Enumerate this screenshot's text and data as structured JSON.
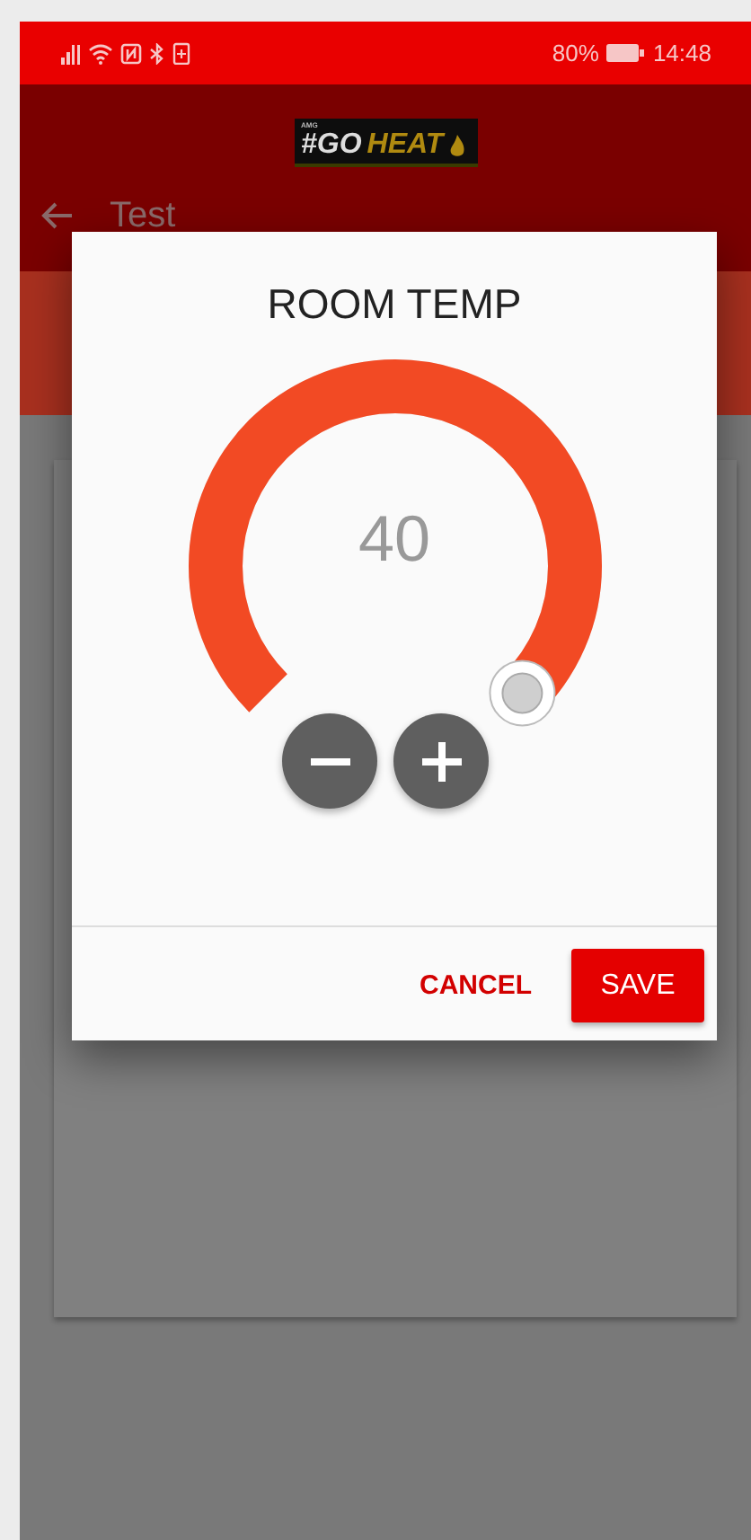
{
  "status_bar": {
    "battery": "80%",
    "time": "14:48"
  },
  "app_bar": {
    "logo": {
      "small": "AMG",
      "hash": "#GO",
      "word": "HEAT"
    },
    "title": "Test"
  },
  "dialog": {
    "title": "ROOM TEMP",
    "dial": {
      "value": "40",
      "level": 1
    },
    "buttons": [
      {
        "label": "CANCEL",
        "kind": "text"
      },
      {
        "label": "SAVE",
        "kind": "filled"
      }
    ]
  }
}
